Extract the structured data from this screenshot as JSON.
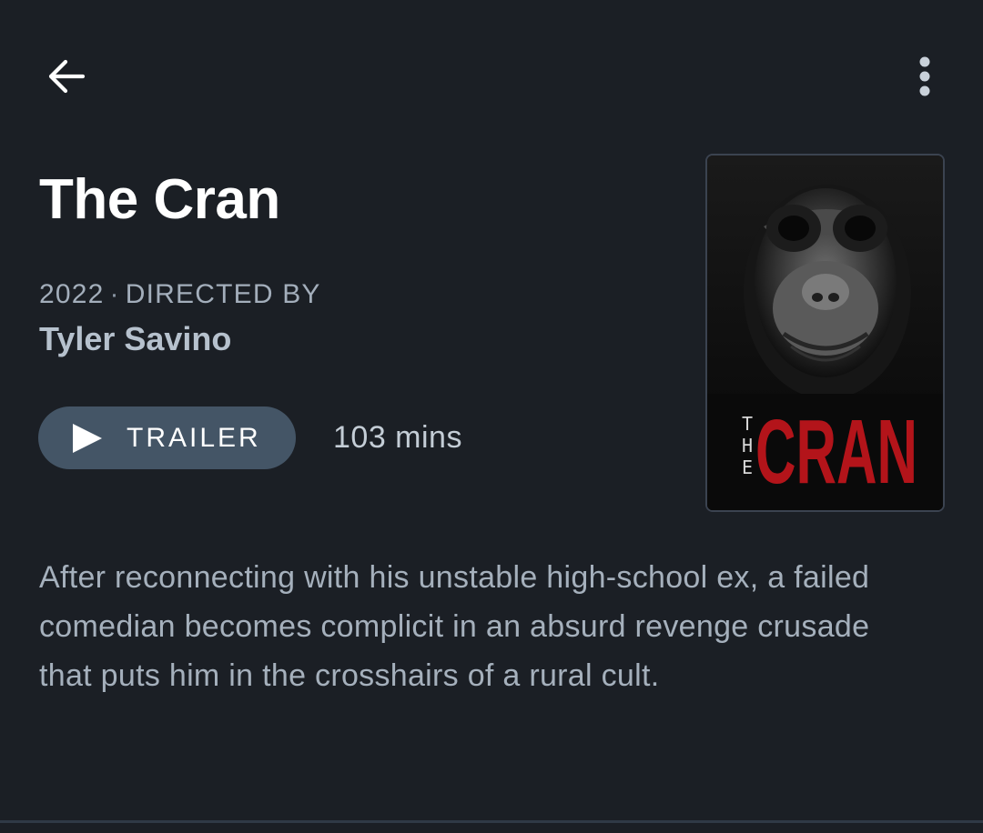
{
  "film": {
    "title": "The Cran",
    "year": "2022",
    "meta_separator": "·",
    "directed_by_label": "DIRECTED BY",
    "director": "Tyler Savino",
    "runtime": "103 mins",
    "synopsis": "After reconnecting with his unstable high-school ex, a failed comedian becomes complicit in an absurd revenge crusade that puts him in the crosshairs of a rural cult."
  },
  "actions": {
    "trailer_label": "TRAILER",
    "back_icon": "arrow-left-icon",
    "menu_icon": "more-vertical-icon",
    "play_icon": "play-icon"
  },
  "poster": {
    "title_small": "THE",
    "title_large": "CRAN"
  },
  "colors": {
    "background": "#1b1f25",
    "button": "#445566",
    "title": "#ffffff",
    "secondary_text": "#a5b0bc",
    "poster_red": "#b3141a"
  }
}
